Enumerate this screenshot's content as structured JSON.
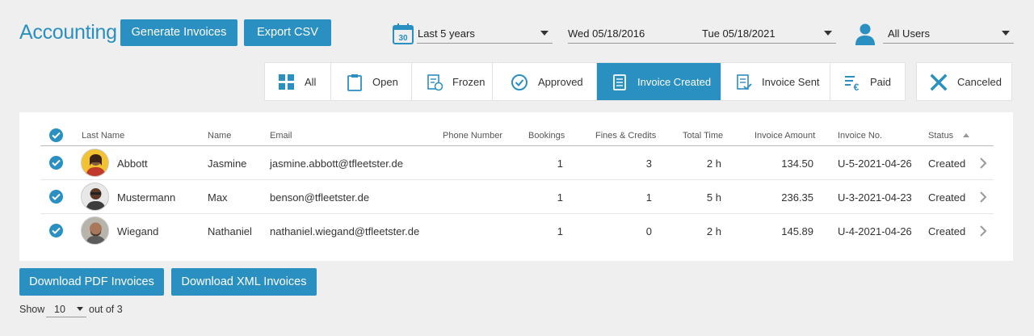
{
  "header": {
    "title": "Accounting",
    "generate_label": "Generate Invoices",
    "export_label": "Export CSV",
    "period_calendar_day": "30",
    "period_value": "Last 5 years",
    "date_from": "Wed 05/18/2016",
    "date_to": "Tue 05/18/2021",
    "users_value": "All Users"
  },
  "filters": {
    "tabs": [
      {
        "label": "All",
        "icon": "grid-icon"
      },
      {
        "label": "Open",
        "icon": "clipboard-icon"
      },
      {
        "label": "Frozen",
        "icon": "frozen-doc-icon"
      },
      {
        "label": "Approved",
        "icon": "check-circle-icon"
      },
      {
        "label": "Invoice Created",
        "icon": "invoice-doc-icon",
        "active": true
      },
      {
        "label": "Invoice Sent",
        "icon": "invoice-sent-icon"
      },
      {
        "label": "Paid",
        "icon": "euro-list-icon"
      }
    ],
    "canceled_label": "Canceled"
  },
  "table": {
    "columns": [
      "Last Name",
      "Name",
      "Email",
      "Phone Number",
      "Bookings",
      "Fines & Credits",
      "Total Time",
      "Invoice Amount",
      "Invoice No.",
      "Status"
    ],
    "rows": [
      {
        "last_name": "Abbott",
        "name": "Jasmine",
        "email": "jasmine.abbott@tfleetster.de",
        "phone": "",
        "bookings": "1",
        "fines": "3",
        "time": "2 h",
        "amount": "134.50",
        "invoice_no": "U-5-2021-04-26",
        "status": "Created"
      },
      {
        "last_name": "Mustermann",
        "name": "Max",
        "email": "benson@tfleetster.de",
        "phone": "",
        "bookings": "1",
        "fines": "1",
        "time": "5 h",
        "amount": "236.35",
        "invoice_no": "U-3-2021-04-23",
        "status": "Created"
      },
      {
        "last_name": "Wiegand",
        "name": "Nathaniel",
        "email": "nathaniel.wiegand@tfleetster.de",
        "phone": "",
        "bookings": "1",
        "fines": "0",
        "time": "2 h",
        "amount": "145.89",
        "invoice_no": "U-4-2021-04-26",
        "status": "Created"
      }
    ]
  },
  "footer": {
    "pdf_label": "Download PDF Invoices",
    "xml_label": "Download XML Invoices",
    "show_label": "Show",
    "page_size": "10",
    "out_of": "out of 3"
  },
  "colors": {
    "accent": "#2a8fc1",
    "background": "#efefef"
  }
}
